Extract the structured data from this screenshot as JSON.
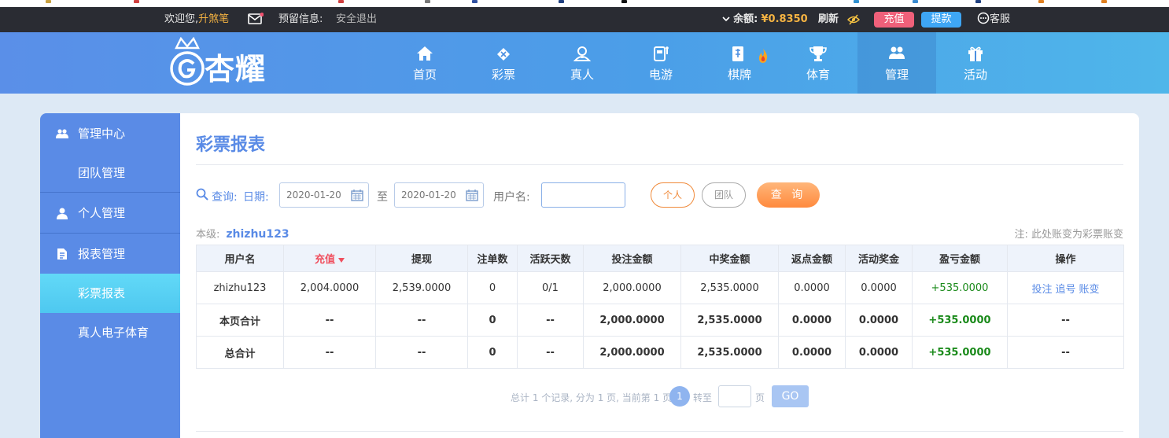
{
  "topbar": {
    "welcome": "欢迎您,",
    "nickname": "升煞笔",
    "reserved_label": "预留信息:",
    "logout": "安全退出",
    "balance_label": "余额:",
    "balance_value": "¥0.8350",
    "refresh": "刷新",
    "recharge": "充值",
    "withdraw": "提款",
    "service": "客服"
  },
  "header": {
    "logo_text": "杏耀",
    "nav": [
      {
        "label": "首页",
        "icon": "home-icon"
      },
      {
        "label": "彩票",
        "icon": "lottery-icon"
      },
      {
        "label": "真人",
        "icon": "live-casino-icon"
      },
      {
        "label": "电游",
        "icon": "slot-machine-icon"
      },
      {
        "label": "棋牌",
        "icon": "cards-icon"
      },
      {
        "label": "体育",
        "icon": "trophy-icon"
      },
      {
        "label": "管理",
        "icon": "users-icon",
        "active": true
      },
      {
        "label": "活动",
        "icon": "gift-icon"
      }
    ]
  },
  "sidebar": {
    "items": [
      {
        "label": "管理中心",
        "icon": "users-icon",
        "type": "group"
      },
      {
        "label": "团队管理",
        "type": "child"
      },
      {
        "label": "个人管理",
        "icon": "user-icon",
        "type": "group"
      },
      {
        "label": "报表管理",
        "icon": "report-icon",
        "type": "group"
      },
      {
        "label": "彩票报表",
        "type": "child",
        "active": true
      },
      {
        "label": "真人电子体育",
        "type": "child"
      }
    ]
  },
  "main": {
    "title": "彩票报表",
    "query": {
      "query_label": "查询:",
      "date_label": "日期:",
      "date_from": "2020-01-20",
      "to_label": "至",
      "date_to": "2020-01-20",
      "username_label": "用户名:",
      "username_value": "",
      "personal_button": "个人",
      "team_button": "团队",
      "submit_button": "查 询"
    },
    "level_label": "本级:",
    "level_user": "zhizhu123",
    "note": "注: 此处账变为彩票账变",
    "table": {
      "headers": [
        "用户名",
        "充值",
        "提现",
        "注单数",
        "活跃天数",
        "投注金额",
        "中奖金额",
        "返点金额",
        "活动奖金",
        "盈亏金额",
        "操作"
      ],
      "rows": [
        {
          "cells": [
            "zhizhu123",
            "2,004.0000",
            "2,539.0000",
            "0",
            "0/1",
            "2,000.0000",
            "2,535.0000",
            "0.0000",
            "0.0000",
            "+535.0000"
          ],
          "ops": [
            "投注",
            "追号",
            "账变"
          ]
        }
      ],
      "page_total": [
        "本页合计",
        "--",
        "--",
        "0",
        "--",
        "2,000.0000",
        "2,535.0000",
        "0.0000",
        "0.0000",
        "+535.0000",
        "--"
      ],
      "grand_total": [
        "总合计",
        "--",
        "--",
        "0",
        "--",
        "2,000.0000",
        "2,535.0000",
        "0.0000",
        "0.0000",
        "+535.0000",
        "--"
      ]
    },
    "pagination": {
      "summary": "总计 1 个记录, 分为 1 页, 当前第 1 页",
      "current_page": "1",
      "jump_label": "转至",
      "page_suffix": "页",
      "go": "GO"
    }
  },
  "colors": {
    "brand_blue": "#5a8be6",
    "accent_orange": "#ff8a3d",
    "profit_green": "#1a8a1a",
    "recharge_pink": "#f04f5e",
    "withdraw_blue": "#3ea6f5"
  }
}
